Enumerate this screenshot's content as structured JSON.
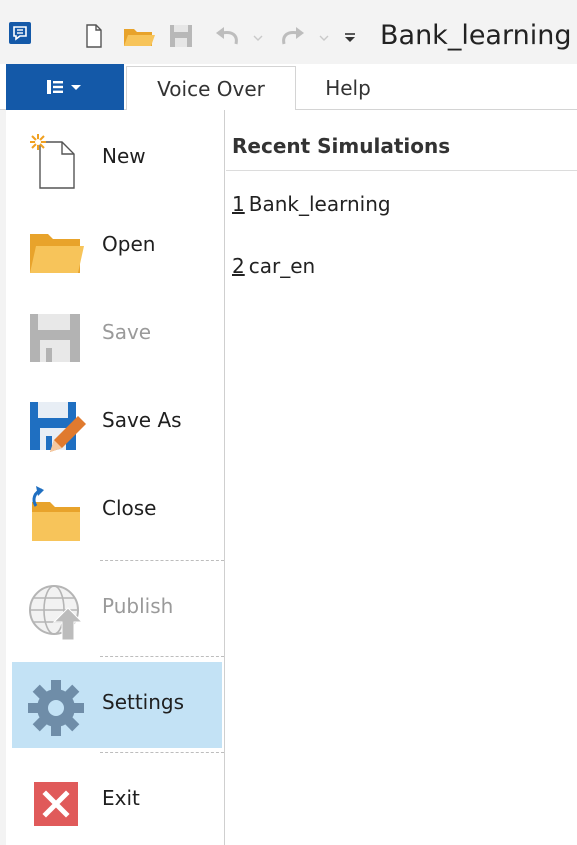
{
  "window": {
    "title": "Bank_learning -"
  },
  "quick_access": {
    "icons": [
      "app-icon",
      "new-document-icon",
      "open-folder-icon",
      "save-icon",
      "undo-icon",
      "redo-icon",
      "customize-qat-icon"
    ]
  },
  "ribbon": {
    "file_tab_icon": "menu-list-icon",
    "tabs": [
      {
        "label": "Voice Over"
      },
      {
        "label": "Help"
      }
    ]
  },
  "menu": {
    "items": [
      {
        "label": "New",
        "icon": "new-document-icon",
        "enabled": true
      },
      {
        "label": "Open",
        "icon": "folder-icon",
        "enabled": true
      },
      {
        "label": "Save",
        "icon": "save-icon",
        "enabled": false
      },
      {
        "label": "Save As",
        "icon": "save-as-icon",
        "enabled": true
      },
      {
        "label": "Close",
        "icon": "close-folder-icon",
        "enabled": true
      },
      {
        "label": "Publish",
        "icon": "publish-globe-icon",
        "enabled": false
      },
      {
        "label": "Settings",
        "icon": "gear-icon",
        "enabled": true,
        "selected": true
      },
      {
        "label": "Exit",
        "icon": "exit-icon",
        "enabled": true
      }
    ]
  },
  "recent": {
    "header": "Recent Simulations",
    "items": [
      {
        "num": "1",
        "name": "Bank_learning"
      },
      {
        "num": "2",
        "name": "car_en"
      }
    ]
  },
  "colors": {
    "file_tab": "#1459a8",
    "selected_item": "#c3e2f5",
    "folder": "#f3b944",
    "exit_red": "#e05a5a"
  }
}
